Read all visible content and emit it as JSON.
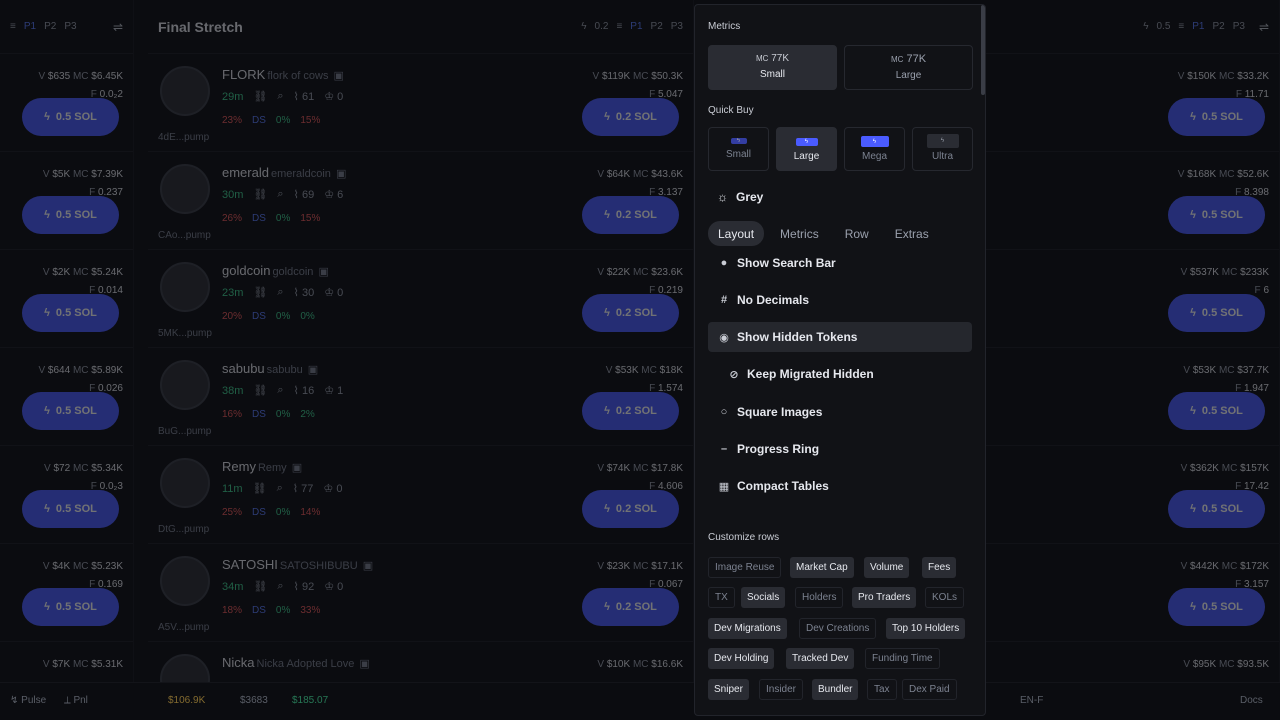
{
  "left_column": {
    "controls": {
      "p1": "P1",
      "p2": "P2",
      "p3": "P3"
    },
    "rows": [
      {
        "v": "$635",
        "mc": "$6.45K",
        "f": "0.0₂2",
        "buy": "0.5 SOL",
        "mc_color": "pink"
      },
      {
        "v": "$5K",
        "mc": "$7.39K",
        "f": "0.237",
        "buy": "0.5 SOL",
        "mc_color": "pink"
      },
      {
        "v": "$2K",
        "mc": "$5.24K",
        "f": "0.014",
        "buy": "0.5 SOL",
        "mc_color": "cyan"
      },
      {
        "v": "$644",
        "mc": "$5.89K",
        "f": "0.026",
        "buy": "0.5 SOL",
        "mc_color": "pink"
      },
      {
        "v": "$72",
        "mc": "$5.34K",
        "f": "0.0₂3",
        "buy": "0.5 SOL",
        "mc_color": "cyan"
      },
      {
        "v": "$4K",
        "mc": "$5.23K",
        "f": "0.169",
        "buy": "0.5 SOL",
        "mc_color": "cyan"
      },
      {
        "v": "$7K",
        "mc": "$5.31K",
        "f": "",
        "buy": "",
        "mc_color": "cyan"
      }
    ]
  },
  "middle_column": {
    "title": "Final Stretch",
    "controls": {
      "amount": "0.2",
      "p1": "P1",
      "p2": "P2",
      "p3": "P3"
    },
    "rows": [
      {
        "name": "FLORK",
        "sub": "flork of cows",
        "age": "29m",
        "n1": "61",
        "n2": "0",
        "addr": "4dE...pump",
        "p1": "23%",
        "p2": "DS",
        "p3": "0%",
        "p4": "15%",
        "v": "$119K",
        "mc": "$50.3K",
        "mc_color": "yellow",
        "f": "5.047",
        "buy": "0.2 SOL"
      },
      {
        "name": "emerald",
        "sub": "emeraldcoin",
        "age": "30m",
        "n1": "69",
        "n2": "6",
        "addr": "CAo...pump",
        "p1": "26%",
        "p2": "DS",
        "p3": "0%",
        "p4": "15%",
        "v": "$64K",
        "mc": "$43.6K",
        "mc_color": "yellow",
        "f": "3.137",
        "buy": "0.2 SOL"
      },
      {
        "name": "goldcoin",
        "sub": "goldcoin",
        "age": "23m",
        "n1": "30",
        "n2": "0",
        "addr": "5MK...pump",
        "p1": "20%",
        "p2": "DS",
        "p3": "0%",
        "p4": "0%",
        "v": "$22K",
        "mc": "$23.6K",
        "mc_color": "cyan",
        "f": "0.219",
        "buy": "0.2 SOL"
      },
      {
        "name": "sabubu",
        "sub": "sabubu",
        "age": "38m",
        "n1": "16",
        "n2": "1",
        "addr": "BuG...pump",
        "p1": "16%",
        "p2": "DS",
        "p3": "0%",
        "p4": "2%",
        "v": "$53K",
        "mc": "$18K",
        "mc_color": "cyan",
        "f": "1.574",
        "buy": "0.2 SOL"
      },
      {
        "name": "Remy",
        "sub": "Remy",
        "age": "11m",
        "n1": "77",
        "n2": "0",
        "addr": "DtG...pump",
        "p1": "25%",
        "p2": "DS",
        "p3": "0%",
        "p4": "14%",
        "v": "$74K",
        "mc": "$17.8K",
        "mc_color": "cyan",
        "f": "4.606",
        "buy": "0.2 SOL"
      },
      {
        "name": "SATOSHI",
        "sub": "SATOSHIBUBU",
        "age": "34m",
        "n1": "92",
        "n2": "0",
        "addr": "A5V...pump",
        "p1": "18%",
        "p2": "DS",
        "p3": "0%",
        "p4": "33%",
        "v": "$23K",
        "mc": "$17.1K",
        "mc_color": "cyan",
        "f": "0.067",
        "buy": "0.2 SOL"
      },
      {
        "name": "Nicka",
        "sub": "Nicka Adopted Love",
        "age": "",
        "n1": "",
        "n2": "",
        "addr": "",
        "p1": "",
        "p2": "",
        "p3": "",
        "p4": "",
        "v": "$10K",
        "mc": "$16.6K",
        "mc_color": "cyan",
        "f": "",
        "buy": ""
      }
    ]
  },
  "right_column": {
    "controls": {
      "amount": "0.5",
      "p1": "P1",
      "p2": "P2",
      "p3": "P3"
    },
    "rows": [
      {
        "v": "$150K",
        "mc": "$33.2K",
        "mc_color": "yellow",
        "f": "11.71",
        "buy": "0.5 SOL"
      },
      {
        "v": "$168K",
        "mc": "$52.6K",
        "mc_color": "yellow",
        "f": "8.398",
        "buy": "0.5 SOL"
      },
      {
        "v": "$537K",
        "mc": "$233K",
        "mc_color": "cyan",
        "f": "6",
        "buy": "0.5 SOL"
      },
      {
        "v": "$53K",
        "mc": "$37.7K",
        "mc_color": "yellow",
        "f": "1.947",
        "buy": "0.5 SOL"
      },
      {
        "v": "$362K",
        "mc": "$157K",
        "mc_color": "cyan",
        "f": "17.42",
        "buy": "0.5 SOL"
      },
      {
        "v": "$442K",
        "mc": "$172K",
        "mc_color": "cyan",
        "f": "3.157",
        "buy": "0.5 SOL"
      },
      {
        "v": "$95K",
        "mc": "$93.5K",
        "mc_color": "cyan",
        "f": "",
        "buy": ""
      }
    ]
  },
  "labels": {
    "v": "V",
    "mc": "MC",
    "f": "F"
  },
  "bottom_bar": {
    "pulse": "Pulse",
    "pnl": "Pnl",
    "bal1": "$106.9K",
    "bal2": "$3683",
    "bal3": "$185.07",
    "lang": "EN-F",
    "docs": "Docs"
  },
  "panel": {
    "metrics_label": "Metrics",
    "metric_small": {
      "mc": "MC",
      "value": "77K",
      "label": "Small"
    },
    "metric_large": {
      "mc": "MC",
      "value": "77K",
      "label": "Large"
    },
    "quick_buy_label": "Quick Buy",
    "quick_buy": [
      {
        "label": "Small",
        "active": false
      },
      {
        "label": "Large",
        "active": true
      },
      {
        "label": "Mega",
        "active": false
      },
      {
        "label": "Ultra",
        "active": false
      }
    ],
    "theme": "Grey",
    "tabs": [
      "Layout",
      "Metrics",
      "Row",
      "Extras"
    ],
    "options": {
      "search_bar": "Show Search Bar",
      "no_decimals": "No Decimals",
      "hidden_tokens": "Show Hidden Tokens",
      "keep_migrated": "Keep Migrated Hidden",
      "square_images": "Square Images",
      "progress_ring": "Progress Ring",
      "compact_tables": "Compact Tables"
    },
    "customize_label": "Customize rows",
    "chips": {
      "image_reuse": "Image Reuse",
      "market_cap": "Market Cap",
      "volume": "Volume",
      "fees": "Fees",
      "tx": "TX",
      "socials": "Socials",
      "holders": "Holders",
      "pro_traders": "Pro Traders",
      "kols": "KOLs",
      "dev_migrations": "Dev Migrations",
      "dev_creations": "Dev Creations",
      "top10": "Top 10 Holders",
      "dev_holding": "Dev Holding",
      "tracked_dev": "Tracked Dev",
      "funding_time": "Funding Time",
      "sniper": "Sniper",
      "insider": "Insider",
      "bundler": "Bundler",
      "tax": "Tax",
      "dex_paid": "Dex Paid"
    }
  },
  "colors": {
    "accent": "#4a5bff",
    "green": "#3ecf8e",
    "red": "#f05a5a",
    "panel_bg": "#111216"
  }
}
